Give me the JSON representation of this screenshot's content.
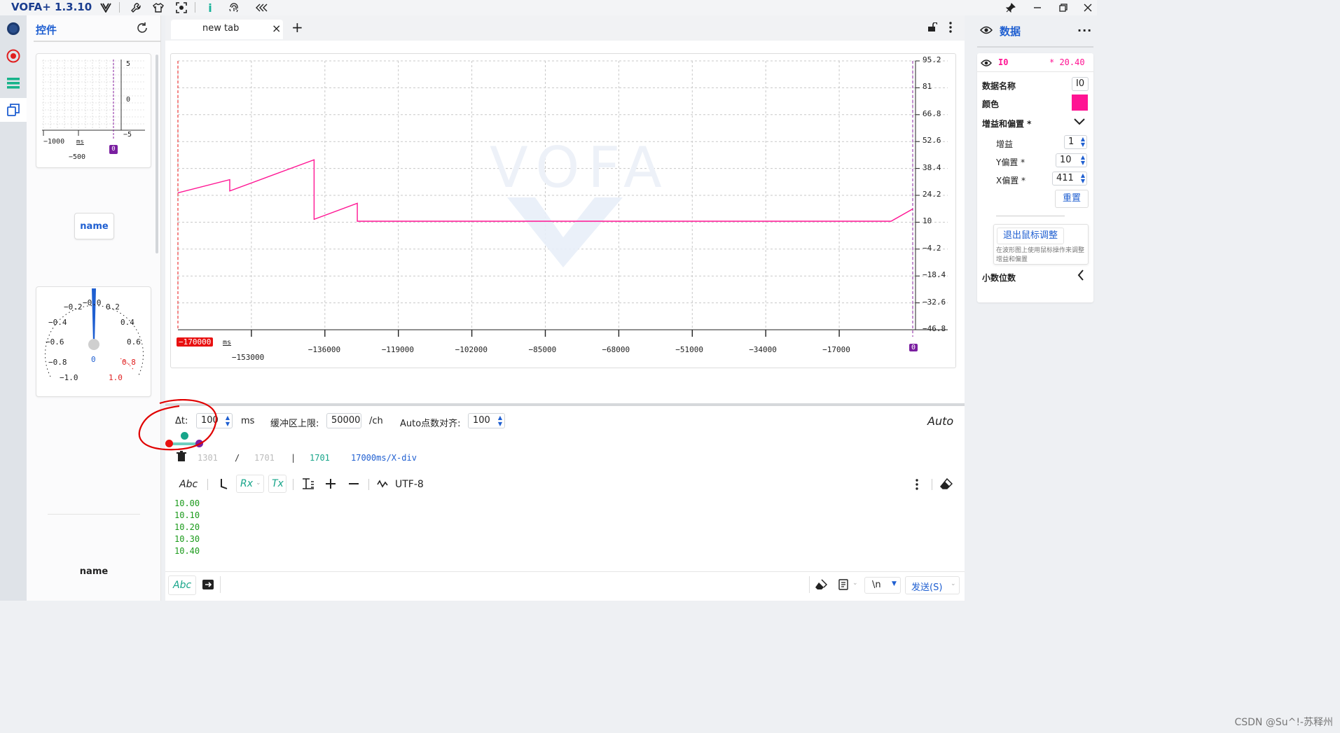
{
  "app": {
    "title": "VOFA+ 1.3.10"
  },
  "controls": {
    "title": "控件",
    "mini_plot": {
      "y_top": "5",
      "y_mid": "0",
      "y_bot": "−5",
      "x_a": "−1000",
      "x_unit": "ms",
      "x_b": "−500",
      "marker": "0"
    },
    "name_button": "name",
    "dial": {
      "labels_left": [
        "−0.2",
        "−0.4",
        "−0.6",
        "−0.8",
        "−1.0"
      ],
      "labels_right": [
        "0.2",
        "0.4",
        "0.6",
        "0.8",
        "1.0"
      ],
      "label_top": "−0.0",
      "value": "0"
    },
    "bottom_name": "name"
  },
  "tabs": {
    "active": "new tab",
    "close": "×",
    "add": "+"
  },
  "plot": {
    "watermark": "VOFA",
    "y_ticks": [
      "95.2",
      "81",
      "66.8",
      "52.6",
      "38.4",
      "24.2",
      "10",
      "−4.2",
      "−18.4",
      "−32.6",
      "−46.8"
    ],
    "x_start": "−170000",
    "x_unit": "ms",
    "x_ticks_low": [
      "−153000"
    ],
    "x_ticks": [
      "−136000",
      "−119000",
      "−102000",
      "−85000",
      "−68000",
      "−51000",
      "−34000",
      "−17000"
    ],
    "x_end_marker": "0",
    "series_color": "#ff1493"
  },
  "chart_data": {
    "type": "line",
    "title": "",
    "xlabel": "ms",
    "ylabel": "",
    "xlim": [
      -170000,
      0
    ],
    "ylim": [
      -46.8,
      95.2
    ],
    "grid": true,
    "series": [
      {
        "name": "I0",
        "x": [
          -170000,
          -158000,
          -158000,
          -138500,
          -138500,
          -128500,
          -128500,
          -85000,
          -5000,
          0
        ],
        "y": [
          25.5,
          32.5,
          26.5,
          43,
          11.5,
          20,
          10.5,
          10.5,
          10.5,
          17
        ]
      }
    ]
  },
  "settings": {
    "dt_label": "Δt:",
    "dt_value": "100",
    "dt_unit": "ms",
    "buffer_label": "缓冲区上限:",
    "buffer_value": "50000",
    "buffer_unit": "/ch",
    "auto_align_label": "Auto点数对齐:",
    "auto_align_value": "100",
    "auto_label": "Auto"
  },
  "counters": {
    "a": "1301",
    "sep1": "/",
    "b": "1701",
    "sep2": "|",
    "c": "1701",
    "per_div": "17000ms/X-div"
  },
  "console_toolbar": {
    "abc": "Abc",
    "rx": "Rx",
    "tx": "Tx",
    "encoding": "UTF-8"
  },
  "console_lines": [
    "10.00",
    "10.10",
    "10.20",
    "10.30",
    "10.40"
  ],
  "send_bar": {
    "abc": "Abc",
    "newline": "\\n",
    "send": "发送(S)"
  },
  "data_panel": {
    "title": "数据",
    "channel_name": "I0",
    "channel_value": "* 20.40",
    "name_label": "数据名称",
    "name_value": "I0",
    "color_label": "颜色",
    "channel_color": "#ff1493",
    "gain_offset_label": "增益和偏置 *",
    "gain_label": "增益",
    "gain_value": "1",
    "y_offset_label": "Y偏置 *",
    "y_offset_value": "10",
    "x_offset_label": "X偏置 *",
    "x_offset_value": "411",
    "reset_label": "重置",
    "exit_mouse_label": "退出鼠标调整",
    "exit_mouse_hint": "在波形图上使用鼠标操作来调整增益和偏置",
    "decimals_label": "小数位数"
  },
  "watermark": "CSDN @Su^!-苏释州"
}
